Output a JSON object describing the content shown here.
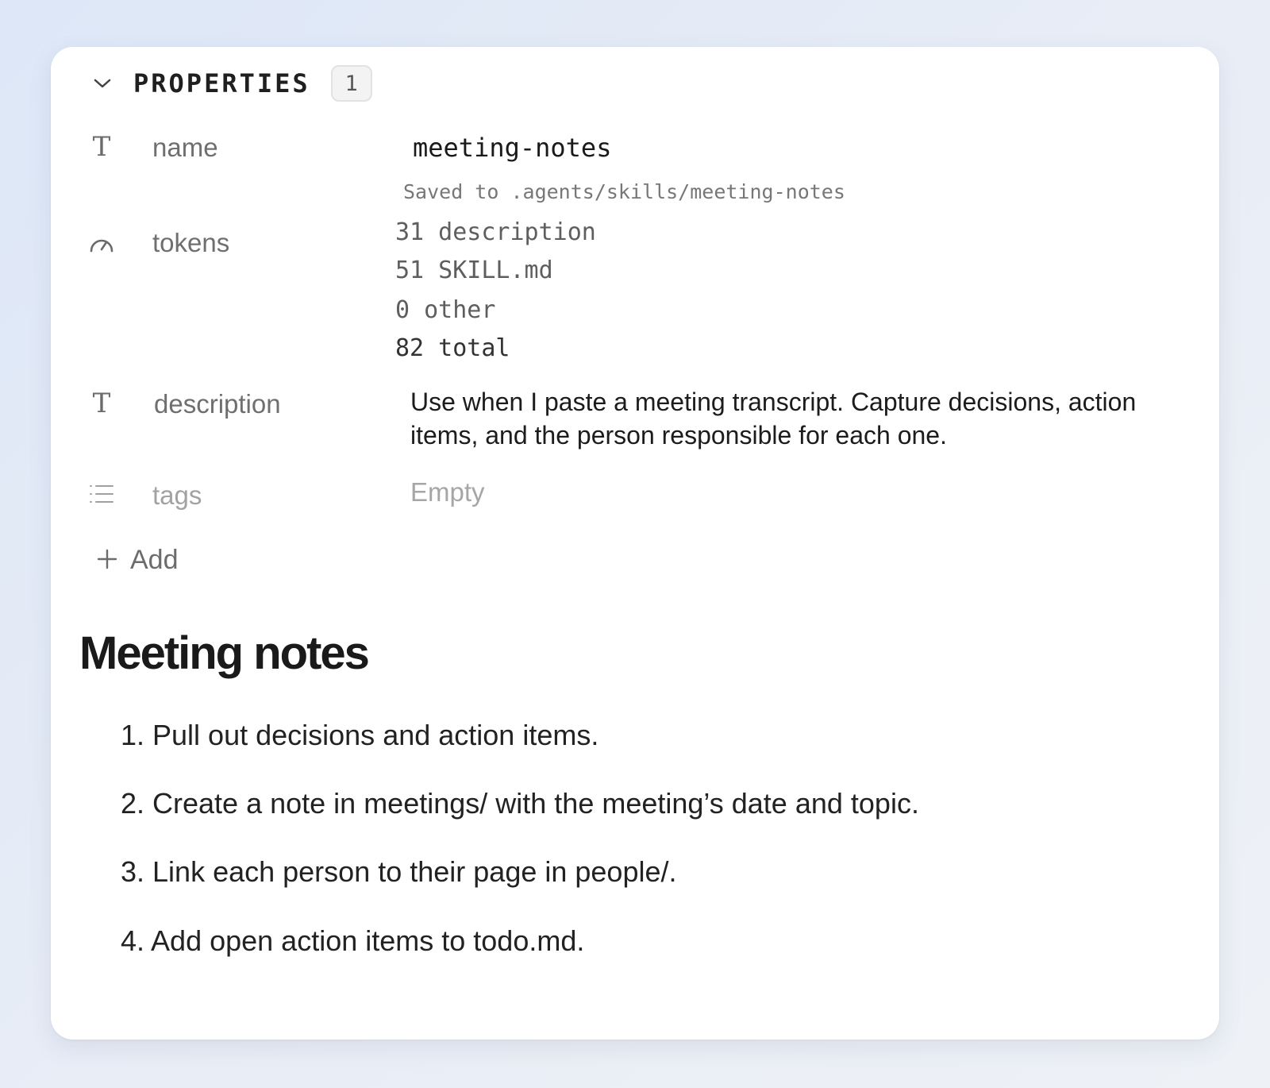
{
  "properties": {
    "title": "PROPERTIES",
    "count": "1"
  },
  "rows": {
    "name": {
      "label": "name",
      "icon": "text-type-icon",
      "value": "meeting-notes",
      "note": "Saved to .agents/skills/meeting-notes"
    },
    "tokens": {
      "label": "tokens",
      "icon": "gauge-icon",
      "lines": [
        "31 description",
        "51 SKILL.md",
        "0 other",
        "82 total"
      ]
    },
    "description": {
      "label": "description",
      "icon": "text-type-icon",
      "value": "Use when I paste a meeting transcript. Capture decisions, action items, and the person responsible for each one."
    },
    "tags": {
      "label": "tags",
      "icon": "list-icon",
      "placeholder": "Empty"
    }
  },
  "add": {
    "icon": "plus-icon",
    "label": "Add"
  },
  "document": {
    "title": "Meeting notes",
    "steps": [
      "1. Pull out decisions and action items.",
      "2. Create a note in meetings/ with the meeting’s date and topic.",
      "3. Link each person to their page in people/.",
      "4. Add open action items to todo.md."
    ]
  }
}
